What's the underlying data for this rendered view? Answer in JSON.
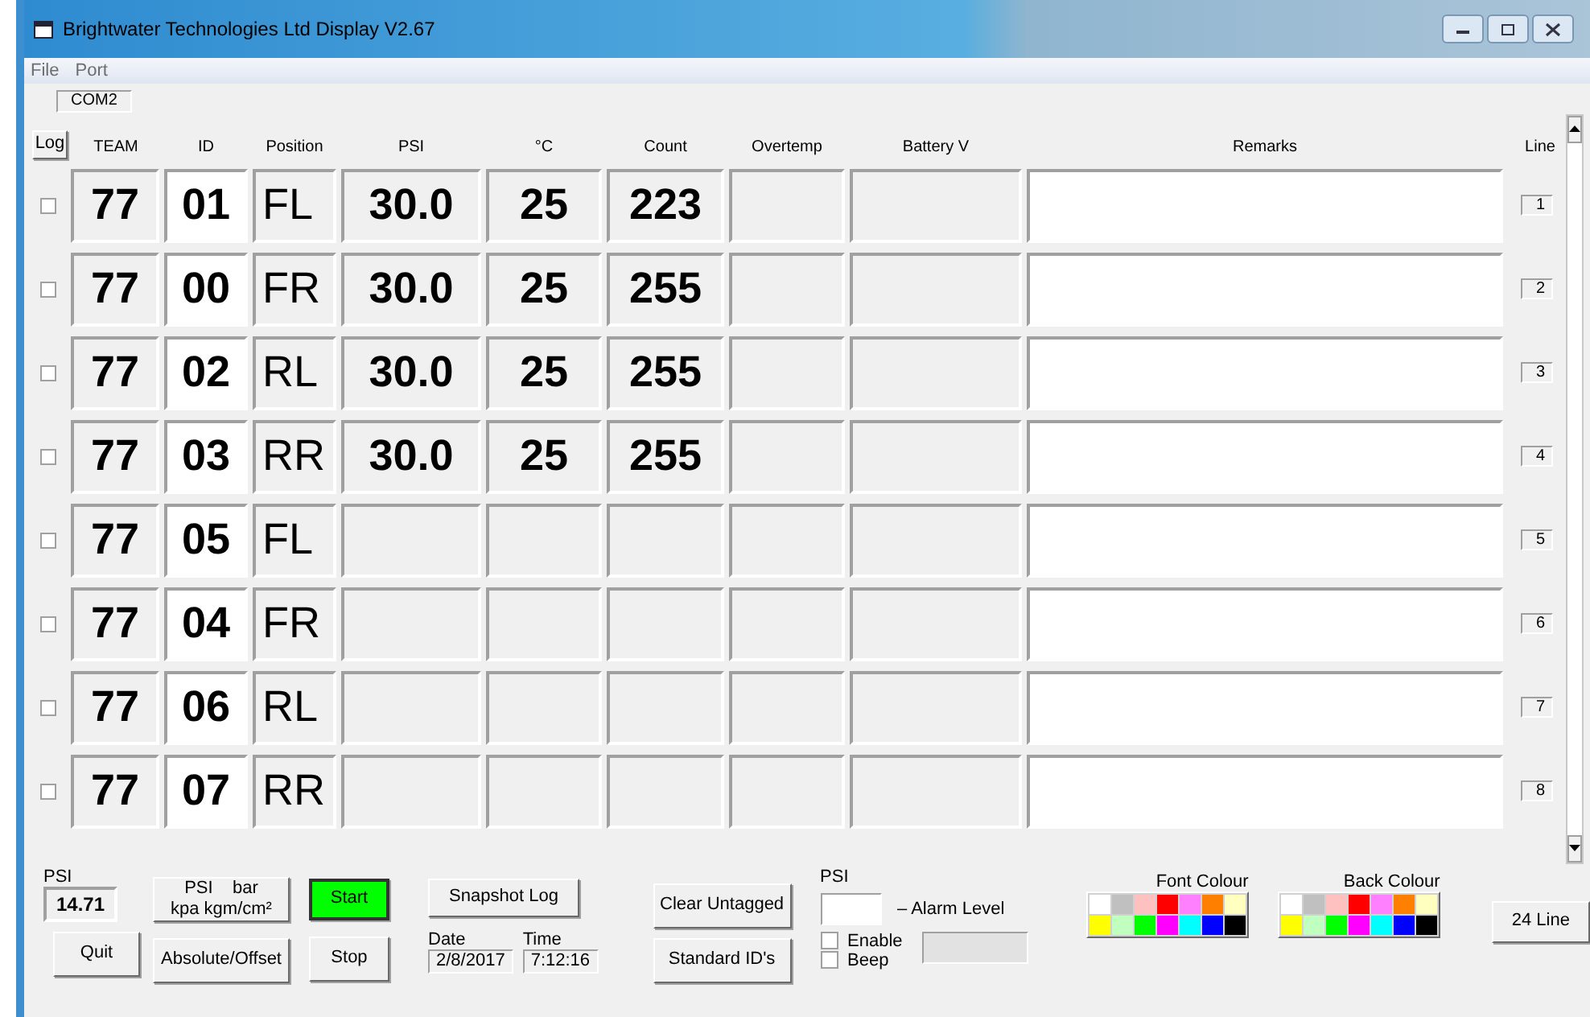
{
  "window": {
    "title": "Brightwater Technologies Ltd  Display V2.67"
  },
  "menu": [
    "File",
    "Port"
  ],
  "port": "COM2",
  "log_button": "Log",
  "columns": [
    "TEAM",
    "ID",
    "Position",
    "PSI",
    "°C",
    "Count",
    "Overtemp",
    "Battery V",
    "Remarks",
    "Line"
  ],
  "rows": [
    {
      "checked": false,
      "team": "77",
      "id": "01",
      "position": "FL",
      "psi": "30.0",
      "temp": "25",
      "count": "223",
      "line": "1"
    },
    {
      "checked": false,
      "team": "77",
      "id": "00",
      "position": "FR",
      "psi": "30.0",
      "temp": "25",
      "count": "255",
      "line": "2"
    },
    {
      "checked": false,
      "team": "77",
      "id": "02",
      "position": "RL",
      "psi": "30.0",
      "temp": "25",
      "count": "255",
      "line": "3"
    },
    {
      "checked": false,
      "team": "77",
      "id": "03",
      "position": "RR",
      "psi": "30.0",
      "temp": "25",
      "count": "255",
      "line": "4"
    },
    {
      "checked": false,
      "team": "77",
      "id": "05",
      "position": "FL",
      "line": "5"
    },
    {
      "checked": false,
      "team": "77",
      "id": "04",
      "position": "FR",
      "line": "6"
    },
    {
      "checked": false,
      "team": "77",
      "id": "06",
      "position": "RL",
      "line": "7"
    },
    {
      "checked": false,
      "team": "77",
      "id": "07",
      "position": "RR",
      "line": "8"
    }
  ],
  "ambient": {
    "label": "PSI",
    "value": "14.71"
  },
  "units_button": {
    "top": [
      "PSI",
      "bar"
    ],
    "bottom": [
      "kpa",
      "kgm/cm²"
    ]
  },
  "buttons": [
    {
      "label": "Start",
      "color": "#00ff00"
    },
    {
      "label": "Stop"
    },
    {
      "label": "Snapshot Log"
    },
    {
      "label": "Clear Untagged"
    },
    {
      "label": "Quit"
    },
    {
      "label": "Absolute/Offset"
    },
    {
      "label": "Standard ID's"
    },
    {
      "label": "24 Line"
    }
  ],
  "date": {
    "label": "Date",
    "value": "2/8/2017"
  },
  "time": {
    "label": "Time",
    "value": "7:12:16"
  },
  "alarm": {
    "label": "PSI",
    "caption": "– Alarm Level"
  },
  "options": [
    {
      "label": "Enable",
      "checked": false
    },
    {
      "label": "Beep",
      "checked": false
    }
  ],
  "font_colour": {
    "label": "Font Colour",
    "swatches": [
      {
        "color": "#ffffff"
      },
      {
        "color": "#c0c0c0"
      },
      {
        "color": "#ffc0c0"
      },
      {
        "color": "#ff0000"
      },
      {
        "color": "#ff80ff"
      },
      {
        "color": "#ff8000"
      },
      {
        "color": "#ffffc0"
      },
      {
        "color": "#ffff00"
      },
      {
        "color": "#c0ffc0"
      },
      {
        "color": "#00ff00"
      },
      {
        "color": "#ff00ff"
      },
      {
        "color": "#00ffff"
      },
      {
        "color": "#0000ff"
      },
      {
        "color": "#000000"
      }
    ]
  },
  "back_colour": {
    "label": "Back Colour",
    "swatches": [
      {
        "color": "#ffffff"
      },
      {
        "color": "#c0c0c0"
      },
      {
        "color": "#ffc0c0"
      },
      {
        "color": "#ff0000"
      },
      {
        "color": "#ff80ff"
      },
      {
        "color": "#ff8000"
      },
      {
        "color": "#ffffc0"
      },
      {
        "color": "#ffff00"
      },
      {
        "color": "#c0ffc0"
      },
      {
        "color": "#00ff00"
      },
      {
        "color": "#ff00ff"
      },
      {
        "color": "#00ffff"
      },
      {
        "color": "#0000ff"
      },
      {
        "color": "#000000"
      }
    ]
  }
}
